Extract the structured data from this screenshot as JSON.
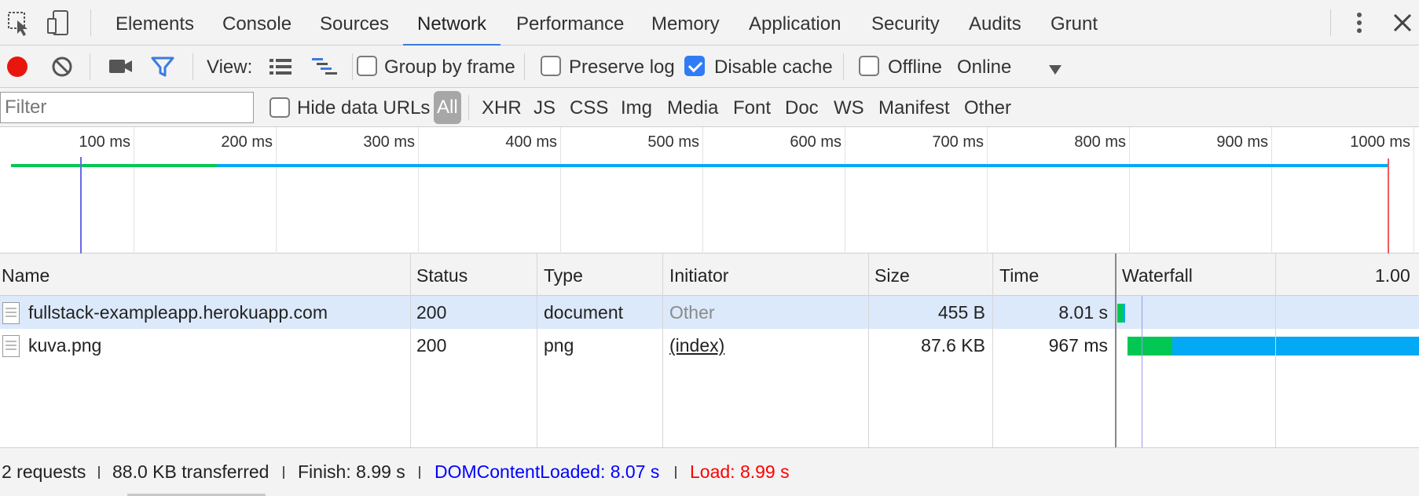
{
  "tabs": [
    {
      "label": "Elements"
    },
    {
      "label": "Console"
    },
    {
      "label": "Sources"
    },
    {
      "label": "Network"
    },
    {
      "label": "Performance"
    },
    {
      "label": "Memory"
    },
    {
      "label": "Application"
    },
    {
      "label": "Security"
    },
    {
      "label": "Audits"
    },
    {
      "label": "Grunt"
    }
  ],
  "active_tab": "Network",
  "toolbar": {
    "view_label": "View:",
    "group_by_frame": {
      "label": "Group by frame",
      "checked": false
    },
    "preserve_log": {
      "label": "Preserve log",
      "checked": false
    },
    "disable_cache": {
      "label": "Disable cache",
      "checked": true
    },
    "offline": {
      "label": "Offline",
      "checked": false
    },
    "throttle": "Online"
  },
  "filter": {
    "placeholder": "Filter",
    "hide_data_urls": {
      "label": "Hide data URLs",
      "checked": false
    },
    "types": [
      "All",
      "XHR",
      "JS",
      "CSS",
      "Img",
      "Media",
      "Font",
      "Doc",
      "WS",
      "Manifest",
      "Other"
    ],
    "active_type": "All"
  },
  "overview": {
    "ticks": [
      "100 ms",
      "200 ms",
      "300 ms",
      "400 ms",
      "500 ms",
      "600 ms",
      "700 ms",
      "800 ms",
      "900 ms",
      "1000 ms"
    ]
  },
  "table": {
    "headers": {
      "name": "Name",
      "status": "Status",
      "type": "Type",
      "initiator": "Initiator",
      "size": "Size",
      "time": "Time",
      "waterfall": "Waterfall",
      "waterfall_scale": "1.00"
    },
    "rows": [
      {
        "name": "fullstack-exampleapp.herokuapp.com",
        "status": "200",
        "type": "document",
        "initiator": "Other",
        "size": "455 B",
        "time": "8.01 s"
      },
      {
        "name": "kuva.png",
        "status": "200",
        "type": "png",
        "initiator": "(index)",
        "size": "87.6 KB",
        "time": "967 ms"
      }
    ]
  },
  "status": {
    "requests": "2 requests",
    "transferred": "88.0 KB transferred",
    "finish": "Finish: 8.99 s",
    "dom_content_loaded": "DOMContentLoaded: 8.07 s",
    "load": "Load: 8.99 s"
  },
  "colors": {
    "accent": "#3b7be0",
    "record": "#e8160c",
    "waiting": "#00c853",
    "download": "#03a9f4",
    "dcl": "#0000ff",
    "load": "#ff0000"
  }
}
